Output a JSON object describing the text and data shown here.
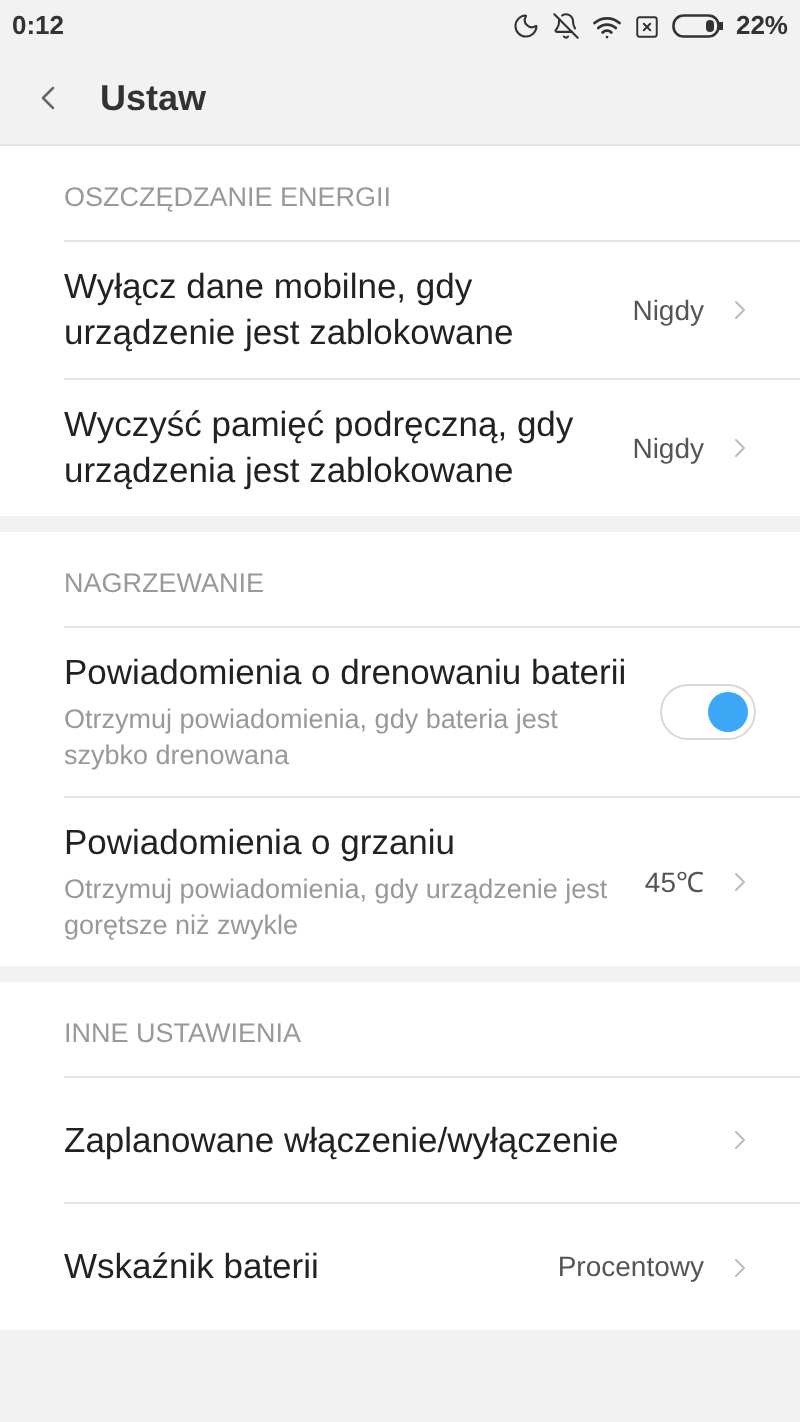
{
  "status_bar": {
    "time": "0:12",
    "battery": "22%"
  },
  "header": {
    "title": "Ustaw"
  },
  "sections": [
    {
      "title": "OSZCZĘDZANIE ENERGII",
      "items": [
        {
          "kind": "value",
          "title": "Wyłącz dane mobilne, gdy urządzenie jest zablokowane",
          "value": "Nigdy"
        },
        {
          "kind": "value",
          "title": "Wyczyść pamięć podręczną, gdy urządzenia jest zablokowane",
          "value": "Nigdy"
        }
      ]
    },
    {
      "title": "NAGRZEWANIE",
      "items": [
        {
          "kind": "toggle",
          "title": "Powiadomienia o drenowaniu baterii",
          "subtitle": "Otrzymuj powiadomienia, gdy bateria jest szybko drenowana",
          "on": true
        },
        {
          "kind": "value",
          "title": "Powiadomienia o grzaniu",
          "subtitle": "Otrzymuj powiadomienia, gdy urządzenie jest gorętsze niż zwykle",
          "value": "45℃"
        }
      ]
    },
    {
      "title": "INNE USTAWIENIA",
      "items": [
        {
          "kind": "value",
          "title": "Zaplanowane włączenie/wyłączenie"
        },
        {
          "kind": "value",
          "title": "Wskaźnik baterii",
          "value": "Procentowy"
        }
      ]
    }
  ]
}
